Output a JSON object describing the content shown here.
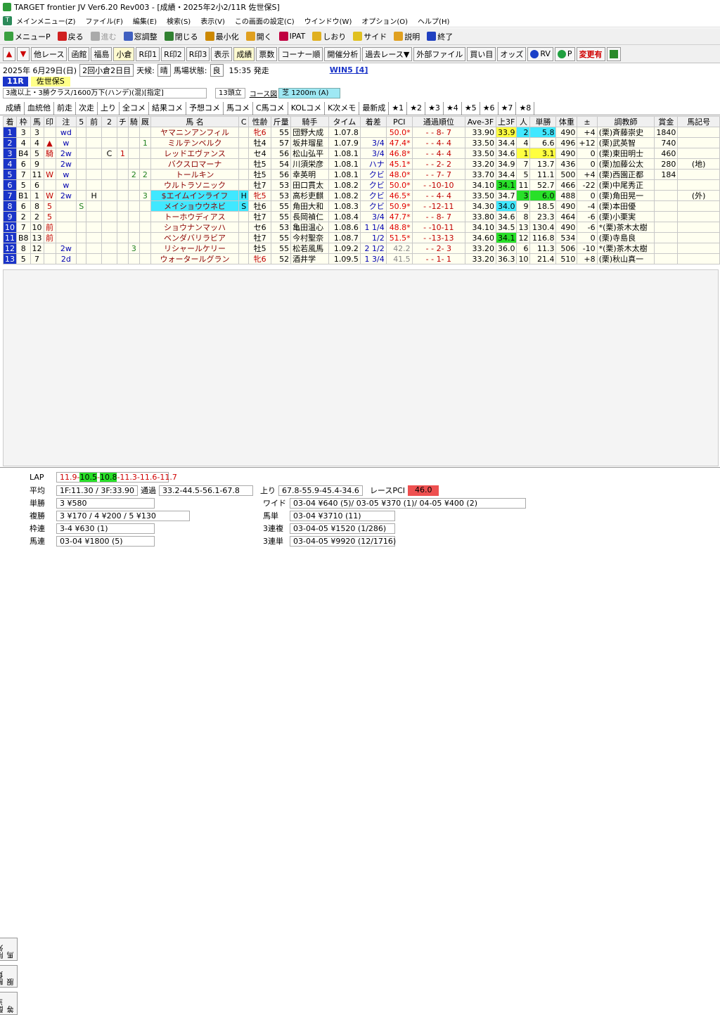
{
  "window": {
    "title": "TARGET frontier JV  Ver6.20  Rev003 - [成績・2025年2小2/11R 佐世保S]"
  },
  "menu": [
    "メインメニュー(Z)",
    "ファイル(F)",
    "編集(E)",
    "検索(S)",
    "表示(V)",
    "この画面の設定(C)",
    "ウインドウ(W)",
    "オプション(O)",
    "ヘルプ(H)"
  ],
  "toolbar1": [
    {
      "label": "メニューP",
      "icon": "menu-icon",
      "color": "#3aa040"
    },
    {
      "label": "戻る",
      "icon": "back-arrow-icon",
      "color": "#d02020"
    },
    {
      "label": "進む",
      "icon": "forward-arrow-icon",
      "color": "#aaaaaa",
      "disabled": true
    },
    {
      "label": "窓調整",
      "icon": "window-adjust-icon",
      "color": "#4060c0"
    },
    {
      "label": "閉じる",
      "icon": "close-door-icon",
      "color": "#308030"
    },
    {
      "label": "最小化",
      "icon": "minimize-icon",
      "color": "#cc8800"
    },
    {
      "label": "開く",
      "icon": "open-icon",
      "color": "#e0a020"
    },
    {
      "label": "IPAT",
      "icon": "pat-icon",
      "color": "#c00040"
    },
    {
      "label": "しおり",
      "icon": "bookmark-icon",
      "color": "#e0b020"
    },
    {
      "label": "サイド",
      "icon": "side-icon",
      "color": "#e0c020"
    },
    {
      "label": "説明",
      "icon": "help-icon",
      "color": "#e0a020"
    },
    {
      "label": "終了",
      "icon": "exit-icon",
      "color": "#2040c0"
    }
  ],
  "toolbar2": [
    "他レース",
    "函館",
    "福島",
    "小倉",
    "R印1",
    "R印2",
    "R印3",
    "表示",
    "成績",
    "票数",
    "コーナー順",
    "開催分析",
    "過去レース▼",
    "外部ファイル",
    "買い目",
    "オッズ",
    "RV",
    "P",
    "変更有"
  ],
  "info": {
    "date": "2025年  6月29日(日)",
    "meeting": "2回小倉2日目",
    "weather_label": "天候:",
    "weather": "晴",
    "track_label": "馬場状態:",
    "track": "良",
    "start": "15:35 発走",
    "win5": "WIN5 [4]"
  },
  "race": {
    "number": "11R",
    "name": "佐世保S",
    "condition": "3歳以上・3勝クラス/1600万下(ハンデ)(混)[指定]",
    "heads": "13頭立",
    "course_label": "コース図",
    "track": "芝 1200m (A)"
  },
  "tabs": [
    "成績",
    "血統他",
    "前走",
    "次走",
    "上り",
    "全コメ",
    "結果コメ",
    "予想コメ",
    "馬コメ",
    "C馬コメ",
    "KOLコメ",
    "K次メモ",
    "最新成",
    "★1",
    "★2",
    "★3",
    "★4",
    "★5",
    "★6",
    "★7",
    "★8"
  ],
  "columns": [
    "着",
    "枠",
    "馬",
    "印",
    "注",
    "5",
    "前",
    "2",
    "チ",
    "騎",
    "厩",
    "馬 名",
    "C",
    "性齢",
    "斤量",
    "騎手",
    "タイム",
    "着差",
    "PCI",
    "通過順位",
    "Ave-3F",
    "上3F",
    "人",
    "単勝",
    "体重",
    "±",
    "調教師",
    "賞金",
    "馬記号"
  ],
  "rows": [
    {
      "pos": "1",
      "waku": "3",
      "uma": "3",
      "mark": "",
      "chu": "wd",
      "m5": "",
      "mae": "",
      "m2": "",
      "chi": "",
      "ki": "",
      "kyu": "",
      "name": "ヤマニンアンフィル",
      "c": "",
      "sex": "牝6",
      "kin": "55",
      "jockey": "団野大成",
      "time": "1.07.8",
      "margin": "",
      "pci": "50.0*",
      "pass": "- - 8- 7",
      "ave": "33.90",
      "agari": "33.9",
      "ninki": "2",
      "odds": "5.8",
      "weight": "490",
      "diff": "+4",
      "trainer": "(栗)斉藤崇史",
      "prize": "1840",
      "kigo": ""
    },
    {
      "pos": "2",
      "waku": "4",
      "uma": "4",
      "mark": "▲",
      "chu": "w",
      "m5": "",
      "mae": "",
      "m2": "",
      "chi": "",
      "ki": "",
      "kyu": "1",
      "name": "ミルテンベルク",
      "c": "",
      "sex": "牡4",
      "kin": "57",
      "jockey": "坂井瑠星",
      "time": "1.07.9",
      "margin": "3/4",
      "pci": "47.4*",
      "pass": "- - 4- 4",
      "ave": "33.50",
      "agari": "34.4",
      "ninki": "4",
      "odds": "6.6",
      "weight": "496",
      "diff": "+12",
      "trainer": "(栗)武英智",
      "prize": "740",
      "kigo": ""
    },
    {
      "pos": "3",
      "waku": "B4",
      "uma": "5",
      "mark": "騎",
      "chu": "2w",
      "m5": "",
      "mae": "",
      "m2": "C",
      "chi": "1",
      "ki": "",
      "kyu": "",
      "name": "レッドエヴァンス",
      "c": "",
      "sex": "セ4",
      "kin": "56",
      "jockey": "松山弘平",
      "time": "1.08.1",
      "margin": "3/4",
      "pci": "46.8*",
      "pass": "- - 4- 4",
      "ave": "33.50",
      "agari": "34.6",
      "ninki": "1",
      "odds": "3.1",
      "weight": "490",
      "diff": "0",
      "trainer": "(栗)東田明士",
      "prize": "460",
      "kigo": ""
    },
    {
      "pos": "4",
      "waku": "6",
      "uma": "9",
      "mark": "",
      "chu": "2w",
      "m5": "",
      "mae": "",
      "m2": "",
      "chi": "",
      "ki": "",
      "kyu": "",
      "name": "バクスロマーナ",
      "c": "",
      "sex": "牡5",
      "kin": "54",
      "jockey": "川須栄彦",
      "time": "1.08.1",
      "margin": "ハナ",
      "pci": "45.1*",
      "pass": "- - 2- 2",
      "ave": "33.20",
      "agari": "34.9",
      "ninki": "7",
      "odds": "13.7",
      "weight": "436",
      "diff": "0",
      "trainer": "(栗)加藤公太",
      "prize": "280",
      "kigo": "(地)"
    },
    {
      "pos": "5",
      "waku": "7",
      "uma": "11",
      "mark": "W",
      "chu": "w",
      "m5": "",
      "mae": "",
      "m2": "",
      "chi": "",
      "ki": "2",
      "kyu": "2",
      "name": "トールキン",
      "c": "",
      "sex": "牡5",
      "kin": "56",
      "jockey": "幸英明",
      "time": "1.08.1",
      "margin": "クビ",
      "pci": "48.0*",
      "pass": "- - 7- 7",
      "ave": "33.70",
      "agari": "34.4",
      "ninki": "5",
      "odds": "11.1",
      "weight": "500",
      "diff": "+4",
      "trainer": "(栗)西園正都",
      "prize": "184",
      "kigo": ""
    },
    {
      "pos": "6",
      "waku": "5",
      "uma": "6",
      "mark": "",
      "chu": "w",
      "m5": "",
      "mae": "",
      "m2": "",
      "chi": "",
      "ki": "",
      "kyu": "",
      "name": "ウルトラソニック",
      "c": "",
      "sex": "牡7",
      "kin": "53",
      "jockey": "田口貫太",
      "time": "1.08.2",
      "margin": "クビ",
      "pci": "50.0*",
      "pass": "- -10-10",
      "ave": "34.10",
      "agari": "34.1",
      "ninki": "11",
      "odds": "52.7",
      "weight": "466",
      "diff": "-22",
      "trainer": "(栗)中尾秀正",
      "prize": "",
      "kigo": ""
    },
    {
      "pos": "7",
      "waku": "B1",
      "uma": "1",
      "mark": "W",
      "chu": "2w",
      "m5": "",
      "mae": "H",
      "m2": "",
      "chi": "",
      "ki": "",
      "kyu": "3",
      "name": "$エイムインライフ",
      "c": "H",
      "sex": "牝5",
      "kin": "53",
      "jockey": "高杉吏麒",
      "time": "1.08.2",
      "margin": "クビ",
      "pci": "46.5*",
      "pass": "- - 4- 4",
      "ave": "33.50",
      "agari": "34.7",
      "ninki": "3",
      "odds": "6.0",
      "weight": "488",
      "diff": "0",
      "trainer": "(栗)角田晃一",
      "prize": "",
      "kigo": "(外)"
    },
    {
      "pos": "8",
      "waku": "6",
      "uma": "8",
      "mark": "5",
      "chu": "",
      "m5": "S",
      "mae": "",
      "m2": "",
      "chi": "",
      "ki": "",
      "kyu": "",
      "name": "メイショウウネビ",
      "c": "S",
      "sex": "牡6",
      "kin": "55",
      "jockey": "角田大和",
      "time": "1.08.3",
      "margin": "クビ",
      "pci": "50.9*",
      "pass": "- -12-11",
      "ave": "34.30",
      "agari": "34.0",
      "ninki": "9",
      "odds": "18.5",
      "weight": "490",
      "diff": "-4",
      "trainer": "(栗)本田優",
      "prize": "",
      "kigo": ""
    },
    {
      "pos": "9",
      "waku": "2",
      "uma": "2",
      "mark": "5",
      "chu": "",
      "m5": "",
      "mae": "",
      "m2": "",
      "chi": "",
      "ki": "",
      "kyu": "",
      "name": "トーホウディアス",
      "c": "",
      "sex": "牡7",
      "kin": "55",
      "jockey": "長岡禎仁",
      "time": "1.08.4",
      "margin": "3/4",
      "pci": "47.7*",
      "pass": "- - 8- 7",
      "ave": "33.80",
      "agari": "34.6",
      "ninki": "8",
      "odds": "23.3",
      "weight": "464",
      "diff": "-6",
      "trainer": "(栗)小栗実",
      "prize": "",
      "kigo": ""
    },
    {
      "pos": "10",
      "waku": "7",
      "uma": "10",
      "mark": "前",
      "chu": "",
      "m5": "",
      "mae": "",
      "m2": "",
      "chi": "",
      "ki": "",
      "kyu": "",
      "name": "ショウナンマッハ",
      "c": "",
      "sex": "セ6",
      "kin": "53",
      "jockey": "亀田温心",
      "time": "1.08.6",
      "margin": "1 1/4",
      "pci": "48.8*",
      "pass": "- -10-11",
      "ave": "34.10",
      "agari": "34.5",
      "ninki": "13",
      "odds": "130.4",
      "weight": "490",
      "diff": "-6",
      "trainer": "*(栗)茶木太樹",
      "prize": "",
      "kigo": ""
    },
    {
      "pos": "11",
      "waku": "B8",
      "uma": "13",
      "mark": "前",
      "chu": "",
      "m5": "",
      "mae": "",
      "m2": "",
      "chi": "",
      "ki": "",
      "kyu": "",
      "name": "ベンダバリラビア",
      "c": "",
      "sex": "牡7",
      "kin": "55",
      "jockey": "今村聖奈",
      "time": "1.08.7",
      "margin": "1/2",
      "pci": "51.5*",
      "pass": "- -13-13",
      "ave": "34.60",
      "agari": "34.1",
      "ninki": "12",
      "odds": "116.8",
      "weight": "534",
      "diff": "0",
      "trainer": "(栗)寺島良",
      "prize": "",
      "kigo": ""
    },
    {
      "pos": "12",
      "waku": "8",
      "uma": "12",
      "mark": "",
      "chu": "2w",
      "m5": "",
      "mae": "",
      "m2": "",
      "chi": "",
      "ki": "3",
      "kyu": "",
      "name": "リシャールケリー",
      "c": "",
      "sex": "牡5",
      "kin": "55",
      "jockey": "松若風馬",
      "time": "1.09.2",
      "margin": "2 1/2",
      "pci": "42.2",
      "pass": "- - 2- 3",
      "ave": "33.20",
      "agari": "36.0",
      "ninki": "6",
      "odds": "11.3",
      "weight": "506",
      "diff": "-10",
      "trainer": "*(栗)茶木太樹",
      "prize": "",
      "kigo": ""
    },
    {
      "pos": "13",
      "waku": "5",
      "uma": "7",
      "mark": "",
      "chu": "2d",
      "m5": "",
      "mae": "",
      "m2": "",
      "chi": "",
      "ki": "",
      "kyu": "",
      "name": "ウォータールグラン",
      "c": "",
      "sex": "牝6",
      "kin": "52",
      "jockey": "酒井学",
      "time": "1.09.5",
      "margin": "1 3/4",
      "pci": "41.5",
      "pass": "- - 1- 1",
      "ave": "33.20",
      "agari": "36.3",
      "ninki": "10",
      "odds": "21.4",
      "weight": "510",
      "diff": "+8",
      "trainer": "(栗)秋山真一",
      "prize": "",
      "kigo": ""
    }
  ],
  "bottom": {
    "side_tabs": [
      "配当等",
      "勝負服",
      "除外馬"
    ],
    "lap_label": "LAP",
    "lap": [
      "11.9-",
      "10.5",
      "-",
      "10.8",
      "-11.3-11.6-11.7"
    ],
    "avg_label": "平均",
    "avg": "1F:11.30 / 3F:33.90",
    "pass_label": "通過",
    "pass": "33.2-44.5-56.1-67.8",
    "agari_label": "上り",
    "agari": "67.8-55.9-45.4-34.6",
    "pci_label": "レースPCI",
    "pci": "46.0",
    "tansho_label": "単勝",
    "tansho": "3 ¥580",
    "fukusho_label": "複勝",
    "fukusho": "3 ¥170 / 4 ¥200 / 5 ¥130",
    "wakuren_label": "枠連",
    "wakuren": "3-4 ¥630 (1)",
    "umaren_label": "馬連",
    "umaren": "03-04 ¥1800 (5)",
    "wide_label": "ワイド",
    "wide": "03-04 ¥640 (5)/ 03-05 ¥370 (1)/ 04-05 ¥400 (2)",
    "umatan_label": "馬単",
    "umatan": "03-04 ¥3710 (11)",
    "sanrenpuku_label": "3連複",
    "sanrenpuku": "03-04-05 ¥1520 (1/286)",
    "sanrentan_label": "3連単",
    "sanrentan": "03-04-05 ¥9920 (12/1716)"
  }
}
